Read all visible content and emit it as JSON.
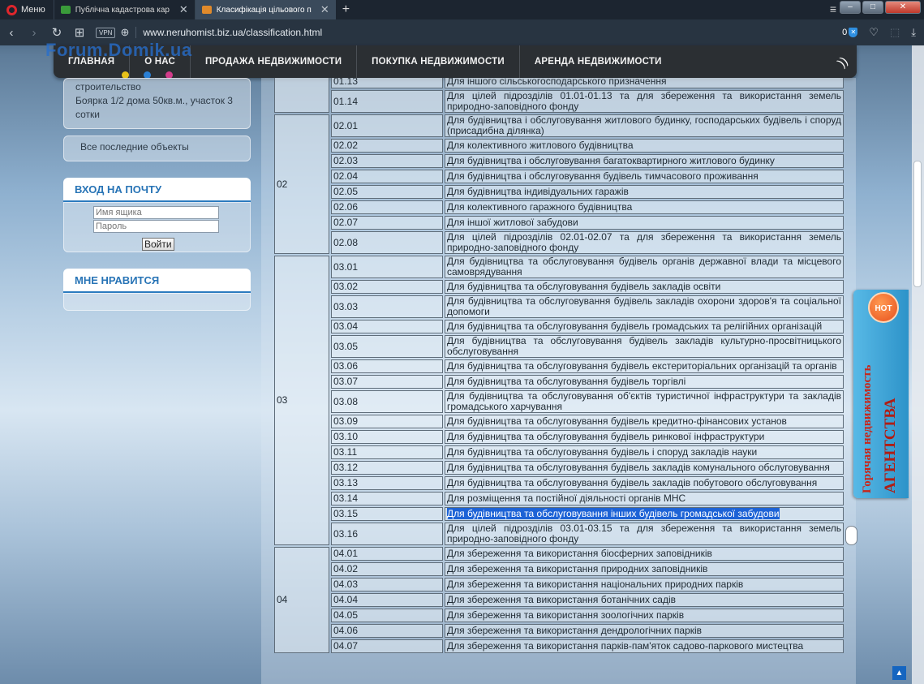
{
  "browser": {
    "menu_label": "Меню",
    "tabs": [
      {
        "title": "Публічна кадастрова кар",
        "active": false,
        "favicon_color": "#3a9b3a"
      },
      {
        "title": "Класифікація цільового п",
        "active": true,
        "favicon_color": "#e08a2b"
      }
    ],
    "vpn_label": "VPN",
    "url": "www.neruhomist.biz.ua/classification.html",
    "adblock_count": "0"
  },
  "site": {
    "watermark": "Forum.Domik.ua",
    "nav": [
      "ГЛАВНАЯ",
      "О НАС",
      "ПРОДАЖА НЕДВИЖИМОСТИ",
      "ПОКУПКА НЕДВИЖИМОСТИ",
      "АРЕНДА НЕДВИЖИМОСТИ"
    ],
    "dot_colors": [
      "#e8c21a",
      "#2a7fd4",
      "#d23b8a"
    ]
  },
  "sidebar": {
    "listing_lines": [
      "строительство",
      "Боярка 1/2 дома 50кв.м., участок 3",
      "сотки"
    ],
    "all_objects": "Все последние объекты",
    "mail_heading": "ВХОД НА ПОЧТУ",
    "mailbox_placeholder": "Имя ящика",
    "password_placeholder": "Пароль",
    "login_button": "Войти",
    "like_heading": "МНЕ НРАВИТСЯ"
  },
  "table": {
    "groups": [
      {
        "group": "",
        "rows": [
          {
            "code": "01.13",
            "desc": "Для іншого сільськогосподарського призначення"
          },
          {
            "code": "01.14",
            "desc": "Для цілей підрозділів 01.01-01.13 та для збереження та використання земель природно-заповідного фонду"
          }
        ]
      },
      {
        "group": "02",
        "rows": [
          {
            "code": "02.01",
            "desc": "Для будівництва і обслуговування житлового будинку, господарських будівель і споруд (присадибна ділянка)"
          },
          {
            "code": "02.02",
            "desc": "Для колективного житлового будівництва"
          },
          {
            "code": "02.03",
            "desc": "Для будівництва і обслуговування багатоквартирного житлового будинку"
          },
          {
            "code": "02.04",
            "desc": "Для будівництва і обслуговування будівель тимчасового проживання"
          },
          {
            "code": "02.05",
            "desc": "Для будівництва індивідуальних гаражів"
          },
          {
            "code": "02.06",
            "desc": "Для колективного гаражного будівництва"
          },
          {
            "code": "02.07",
            "desc": "Для іншої житлової забудови"
          },
          {
            "code": "02.08",
            "desc": "Для цілей підрозділів 02.01-02.07 та для збереження та використання земель природно-заповідного фонду"
          }
        ]
      },
      {
        "group": "03",
        "rows": [
          {
            "code": "03.01",
            "desc": "Для будівництва та обслуговування будівель органів державної влади та місцевого самоврядування"
          },
          {
            "code": "03.02",
            "desc": "Для будівництва та обслуговування будівель закладів освіти"
          },
          {
            "code": "03.03",
            "desc": "Для будівництва та обслуговування будівель закладів охорони здоров'я та соціальної допомоги"
          },
          {
            "code": "03.04",
            "desc": "Для будівництва та обслуговування будівель громадських та релігійних організацій"
          },
          {
            "code": "03.05",
            "desc": "Для будівництва та обслуговування будівель закладів культурно-просвітницького обслуговування"
          },
          {
            "code": "03.06",
            "desc": "Для будівництва та обслуговування будівель екстериторіальних організацій та органів"
          },
          {
            "code": "03.07",
            "desc": "Для будівництва та обслуговування будівель торгівлі"
          },
          {
            "code": "03.08",
            "desc": "Для будівництва та обслуговування об'єктів туристичної інфраструктури та закладів громадського харчування"
          },
          {
            "code": "03.09",
            "desc": "Для будівництва та обслуговування будівель кредитно-фінансових установ"
          },
          {
            "code": "03.10",
            "desc": "Для будівництва та обслуговування будівель ринкової інфраструктури"
          },
          {
            "code": "03.11",
            "desc": "Для будівництва та обслуговування будівель і споруд закладів науки"
          },
          {
            "code": "03.12",
            "desc": "Для будівництва та обслуговування будівель закладів комунального обслуговування"
          },
          {
            "code": "03.13",
            "desc": "Для будівництва та обслуговування будівель закладів побутового обслуговування"
          },
          {
            "code": "03.14",
            "desc": "Для розміщення та постійної діяльності органів МНС"
          },
          {
            "code": "03.15",
            "desc": "Для будівництва та обслуговування інших будівель громадської забудови",
            "selected": true
          },
          {
            "code": "03.16",
            "desc": "Для цілей підрозділів 03.01-03.15 та для збереження та використання земель природно-заповідного фонду"
          }
        ]
      },
      {
        "group": "04",
        "rows": [
          {
            "code": "04.01",
            "desc": "Для збереження та використання біосферних заповідників"
          },
          {
            "code": "04.02",
            "desc": "Для збереження та використання природних заповідників"
          },
          {
            "code": "04.03",
            "desc": "Для збереження та використання національних природних парків"
          },
          {
            "code": "04.04",
            "desc": "Для збереження та використання ботанічних садів"
          },
          {
            "code": "04.05",
            "desc": "Для збереження та використання зоологічних парків"
          },
          {
            "code": "04.06",
            "desc": "Для збереження та використання дендрологічних парків"
          },
          {
            "code": "04.07",
            "desc": "Для збереження та використання парків-пам'яток садово-паркового мистецтва"
          }
        ]
      }
    ]
  },
  "widget": {
    "badge": "HOT",
    "line1": "Горячая недвижимость",
    "line2": "АГЕНТСТВА"
  }
}
